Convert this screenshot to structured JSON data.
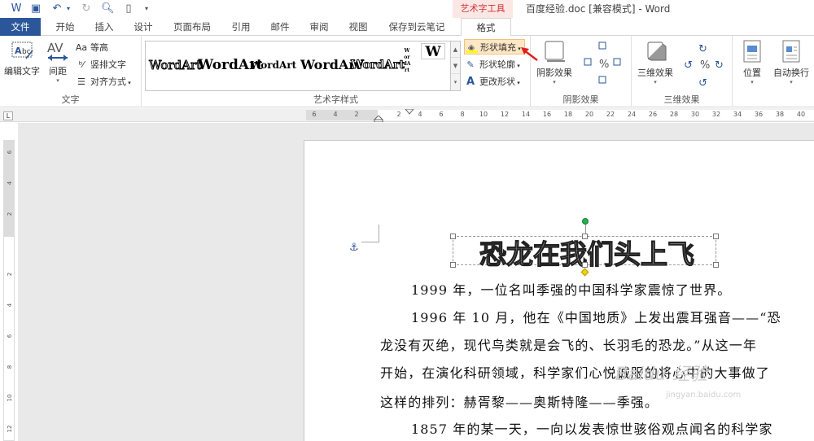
{
  "titlebar": {
    "contextual_group": "艺术字工具",
    "doc_title": "百度经验.doc [兼容模式] - Word"
  },
  "tabs": [
    "文件",
    "开始",
    "插入",
    "设计",
    "页面布局",
    "引用",
    "邮件",
    "审阅",
    "视图",
    "保存到云笔记",
    "格式"
  ],
  "ribbon": {
    "text_group": {
      "edit_text": "编辑文字",
      "spacing": "间距",
      "equal_height": "等高",
      "vertical_text": "竖排文字",
      "align": "对齐方式",
      "label": "文字"
    },
    "wordart_group": {
      "styles": [
        "WordArt",
        "WordArt",
        "WordArt",
        "WordArt",
        "WordArt",
        "WordArt",
        "W"
      ],
      "fill": "形状填充",
      "outline": "形状轮廓",
      "change_shape": "更改形状",
      "label": "艺术字样式"
    },
    "shadow_group": {
      "shadow_effect": "阴影效果",
      "label": "阴影效果"
    },
    "threed_group": {
      "threed_effect": "三维效果",
      "label": "三维效果"
    },
    "arrange_group": {
      "position": "位置",
      "wrap": "自动换行"
    }
  },
  "ruler": {
    "h_ticks": [
      "6",
      "4",
      "2",
      "2",
      "4",
      "6",
      "8",
      "10",
      "12",
      "14",
      "16",
      "18",
      "20",
      "22",
      "24",
      "26",
      "28",
      "30",
      "32",
      "34",
      "36",
      "38",
      "40"
    ],
    "v_ticks": [
      "6",
      "4",
      "2",
      "2",
      "4",
      "6",
      "8",
      "10",
      "12"
    ],
    "corner": "L"
  },
  "document": {
    "wordart_title": "恐龙在我们头上飞",
    "lines": [
      "1999 年，一位名叫季强的中国科学家震惊了世界。",
      "1996 年 10 月，他在《中国地质》上发出震耳强音——“恐",
      "龙没有灭绝，现代鸟类就是会飞的、长羽毛的恐龙。”从这一年",
      "开始，在演化科研领域，科学家们心悦诚服的将心中的大事做了",
      "这样的排列：赫胥黎——奥斯特隆——季强。",
      "1857 年的某一天，一向以发表惊世骇俗观点闻名的科学家"
    ],
    "watermark": "Baidu 经验",
    "watermark_sub": "jingyan.baidu.com"
  },
  "colors": {
    "accent": "#2b579a",
    "contextual": "#c33333",
    "arrow": "#e02020"
  }
}
